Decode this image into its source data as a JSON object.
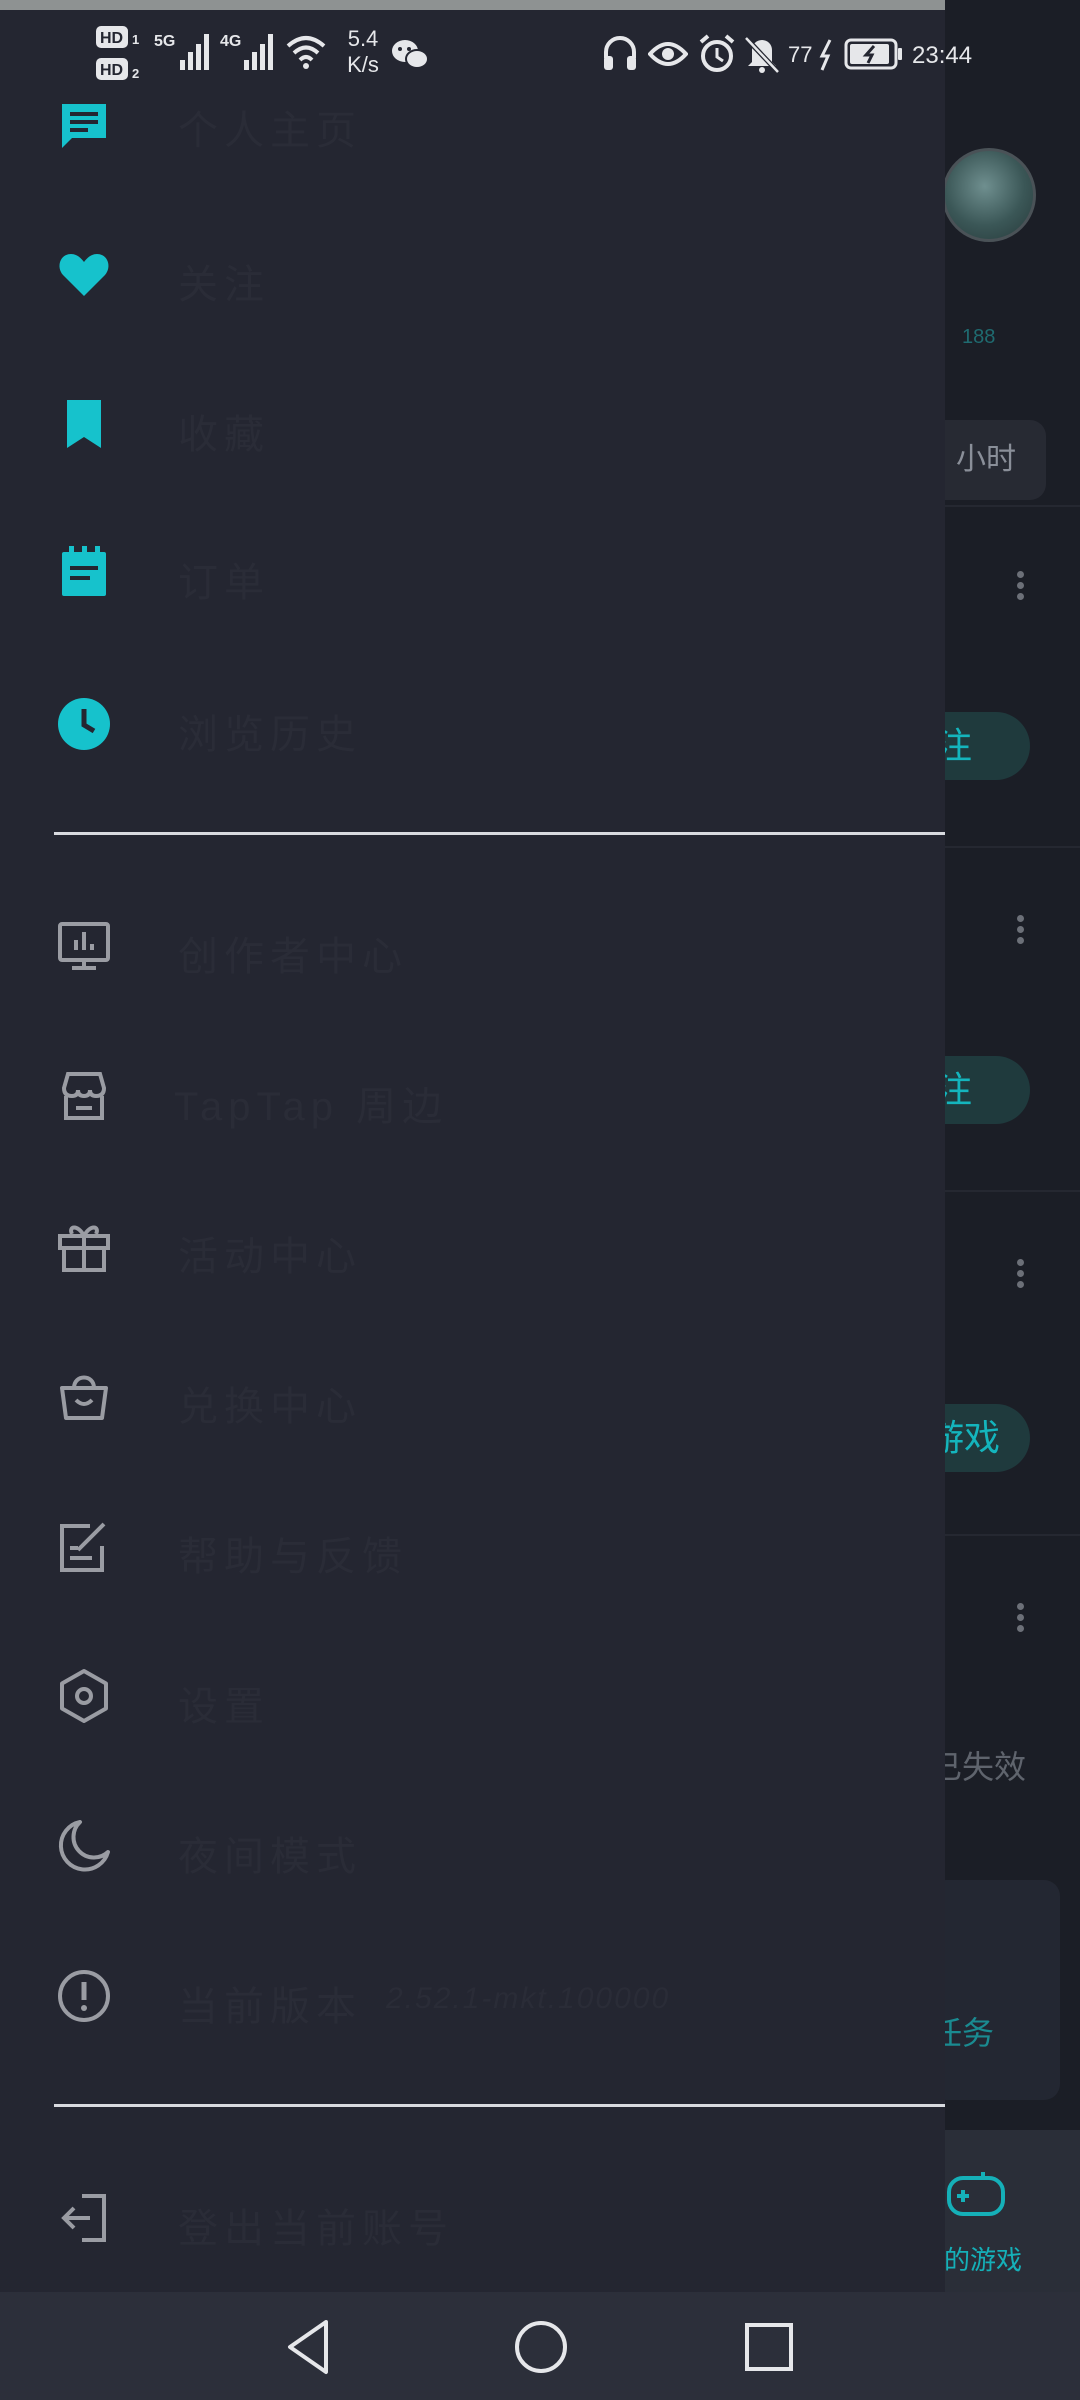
{
  "status_bar": {
    "net_speed_value": "5.4",
    "net_speed_unit": "K/s",
    "battery_percent": "77",
    "time": "23:44",
    "icons": [
      "hd1-icon",
      "hd2-icon",
      "5g-signal-icon",
      "4g-signal-icon",
      "wifi-icon",
      "wechat-icon",
      "headphones-icon",
      "eye-icon",
      "alarm-icon",
      "mute-bell-icon",
      "charging-battery-icon"
    ]
  },
  "drawer": {
    "primary_items": [
      {
        "label": "个人主页",
        "icon": "chat-bubble-icon"
      },
      {
        "label": "关注",
        "icon": "heart-icon"
      },
      {
        "label": "收藏",
        "icon": "bookmark-icon"
      },
      {
        "label": "订单",
        "icon": "notepad-icon"
      },
      {
        "label": "浏览历史",
        "icon": "clock-icon"
      }
    ],
    "secondary_items": [
      {
        "label": "创作者中心",
        "icon": "monitor-chart-icon"
      },
      {
        "label": "TapTap 周边",
        "icon": "store-icon"
      },
      {
        "label": "活动中心",
        "icon": "gift-icon"
      },
      {
        "label": "兑换中心",
        "icon": "shopping-bag-icon"
      },
      {
        "label": "帮助与反馈",
        "icon": "edit-note-icon"
      },
      {
        "label": "设置",
        "icon": "settings-hexagon-icon"
      },
      {
        "label": "夜间模式",
        "icon": "moon-icon"
      },
      {
        "label": "当前版本",
        "version": "2.52.1-mkt.100000",
        "icon": "info-icon"
      }
    ],
    "logout": {
      "label": "登出当前账号",
      "icon": "logout-icon"
    }
  },
  "background_app": {
    "count": "188",
    "time_tab": "小时",
    "follow_button_1": "注",
    "follow_button_2": "注",
    "game_button": "游戏",
    "expired_text": "已失效",
    "task_text": "任务",
    "tab_label": "的游戏"
  },
  "colors": {
    "accent": "#16c2cc",
    "drawer_bg": "#242631",
    "icon_grey": "#9a9ca3"
  }
}
